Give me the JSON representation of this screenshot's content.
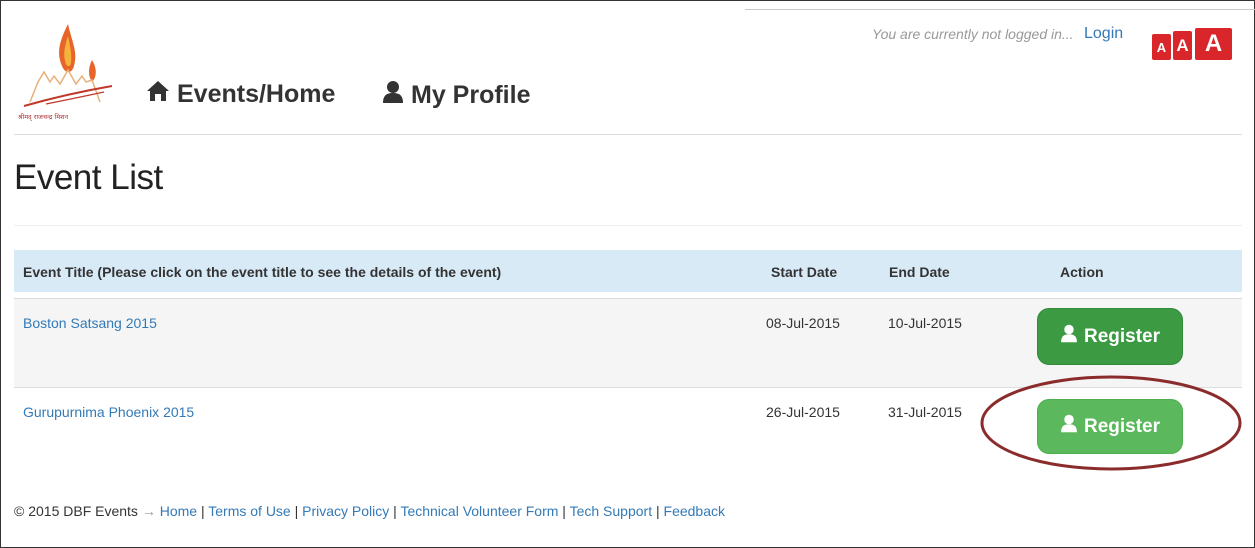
{
  "header": {
    "logo_caption": "श्रीमद् राजचन्द्र मिशन",
    "nav": [
      {
        "label": "Events/Home",
        "icon": "home-icon"
      },
      {
        "label": "My Profile",
        "icon": "user-icon"
      }
    ],
    "login_message": "You are currently not logged in...",
    "login_link": "Login",
    "font_size_buttons": [
      "A",
      "A",
      "A"
    ],
    "accent_color": "#d9262b"
  },
  "page": {
    "title": "Event List"
  },
  "table": {
    "headers": {
      "title": "Event Title (Please click on the event title to see the details of the event)",
      "start": "Start Date",
      "end": "End Date",
      "action": "Action"
    },
    "rows": [
      {
        "title": "Boston Satsang 2015",
        "start": "08-Jul-2015",
        "end": "10-Jul-2015",
        "action": "Register"
      },
      {
        "title": "Gurupurnima Phoenix 2015",
        "start": "26-Jul-2015",
        "end": "31-Jul-2015",
        "action": "Register"
      }
    ],
    "button_colors": [
      "#3c9a43",
      "#5cb85c"
    ]
  },
  "footer": {
    "copyright": "© 2015 DBF Events",
    "arrow": "→",
    "links": [
      "Home",
      "Terms of Use",
      "Privacy Policy",
      "Technical Volunteer Form",
      "Tech Support",
      "Feedback"
    ]
  },
  "annotation_color": "#8b2c2c"
}
